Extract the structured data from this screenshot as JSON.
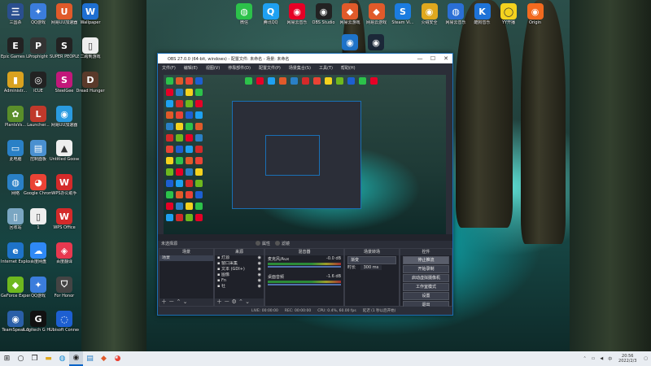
{
  "desktop": {
    "icons_left": [
      {
        "label": "三国杀",
        "color": "#2a4f8f",
        "glyph": "三"
      },
      {
        "label": "Epic Games Launcher",
        "color": "#222",
        "glyph": "E"
      },
      {
        "label": "Administr...",
        "color": "#d9a21f",
        "glyph": "▮"
      },
      {
        "label": "PlantsVs...",
        "color": "#5a8e2a",
        "glyph": "✿"
      },
      {
        "label": "此电脑",
        "color": "#2a80c6",
        "glyph": "▭"
      },
      {
        "label": "网络",
        "color": "#2a80c6",
        "glyph": "◍"
      },
      {
        "label": "回收站",
        "color": "#7aa6c2",
        "glyph": "▯"
      },
      {
        "label": "Internet Explorer",
        "color": "#1e73c9",
        "glyph": "e"
      },
      {
        "label": "GeForce Experience",
        "color": "#6eb81e",
        "glyph": "◆"
      },
      {
        "label": "TeamSpeak 3",
        "color": "#2a5fa8",
        "glyph": "◉"
      }
    ],
    "icons_col2": [
      {
        "label": "QQ游戏",
        "color": "#3b7ddc",
        "glyph": "✦"
      },
      {
        "label": "Prophight",
        "color": "#333",
        "glyph": "P"
      },
      {
        "label": "iCUE",
        "color": "#222",
        "glyph": "◎"
      },
      {
        "label": "Launcher...",
        "color": "#c0392b",
        "glyph": "L"
      },
      {
        "label": "控制面板",
        "color": "#4a90d0",
        "glyph": "▤"
      },
      {
        "label": "Google Chrome",
        "color": "#ea4335",
        "glyph": "◕"
      },
      {
        "label": "1",
        "color": "#eee",
        "glyph": "▯"
      },
      {
        "label": "百度网盘",
        "color": "#2f89f5",
        "glyph": "☁"
      },
      {
        "label": "QQ游戏",
        "color": "#3b7ddc",
        "glyph": "✦"
      },
      {
        "label": "Logitech G HUB",
        "color": "#111",
        "glyph": "G"
      }
    ],
    "icons_col3": [
      {
        "label": "网易UU加速器",
        "color": "#e05a2a",
        "glyph": "U"
      },
      {
        "label": "SUPER PEOPLE CBT",
        "color": "#222",
        "glyph": "S"
      },
      {
        "label": "SteelGee",
        "color": "#c2187a",
        "glyph": "S"
      },
      {
        "label": "网易UU加速器",
        "color": "#2a9be0",
        "glyph": "◉"
      },
      {
        "label": "Untitled Goose...",
        "color": "#eee",
        "glyph": "▲"
      },
      {
        "label": "WPS办公助手",
        "color": "#d42a2a",
        "glyph": "W"
      },
      {
        "label": "WPS Office",
        "color": "#d42a2a",
        "glyph": "W"
      },
      {
        "label": "百度翻译",
        "color": "#e8384f",
        "glyph": "◈"
      },
      {
        "label": "For Honor",
        "color": "#444",
        "glyph": "⛉"
      },
      {
        "label": "Ubisoft Connect",
        "color": "#1d5fd1",
        "glyph": "◌"
      }
    ],
    "icons_col4": [
      {
        "label": "Wallpaper",
        "color": "#1e6fd1",
        "glyph": "W"
      },
      {
        "label": "二跨到游戏",
        "color": "#eee",
        "glyph": "▯"
      },
      {
        "label": "Dread Hunger",
        "color": "#5a3a2a",
        "glyph": "D"
      }
    ],
    "icons_top": [
      {
        "label": "微信",
        "color": "#2cc24a",
        "glyph": "◍"
      },
      {
        "label": "腾讯QQ",
        "color": "#1ea1f2",
        "glyph": "Q"
      },
      {
        "label": "网易云音乐",
        "color": "#e60026",
        "glyph": "◉"
      },
      {
        "label": "OBS Studio",
        "color": "#222",
        "glyph": "◉"
      },
      {
        "label": "网易云游戏",
        "color": "#e05a2a",
        "glyph": "◆"
      },
      {
        "label": "网易云游戏",
        "color": "#e05a2a",
        "glyph": "◆"
      },
      {
        "label": "Steam Vi...",
        "color": "#1b7ce0",
        "glyph": "S"
      },
      {
        "label": "火绒安全",
        "color": "#e0a81e",
        "glyph": "◉"
      },
      {
        "label": "网易云音乐",
        "color": "#2a6fd6",
        "glyph": "◍"
      },
      {
        "label": "酷狗音乐",
        "color": "#1e73d8",
        "glyph": "K"
      },
      {
        "label": "YY开播",
        "color": "#f4d21e",
        "glyph": "◯"
      },
      {
        "label": "Origin",
        "color": "#f26a1f",
        "glyph": "◉"
      }
    ],
    "icons_top2": [
      {
        "label": "",
        "color": "#1e73c9",
        "glyph": "◉"
      },
      {
        "label": "",
        "color": "#1b2838",
        "glyph": "◉"
      }
    ]
  },
  "obs": {
    "title": "OBS 27.0.0 (64-bit, windows) - 配置文件: 未命名 - 场景: 未命名",
    "menu": [
      "文件(F)",
      "编辑(E)",
      "视图(V)",
      "停靠部件(D)",
      "配置文件(P)",
      "场景集合(S)",
      "工具(T)",
      "帮助(H)"
    ],
    "mode_label": "未选择源",
    "mode_props": "属性",
    "mode_filters": "滤镜",
    "docks": {
      "scenes": {
        "title": "场景",
        "items": [
          "场景"
        ]
      },
      "sources": {
        "title": "来源",
        "items": [
          "灯源",
          "窗口采集",
          "文本 (GDI+)",
          "图像",
          "Fn",
          "社"
        ]
      },
      "mixer": {
        "title": "混音器",
        "channels": [
          {
            "name": "麦克风/Aux",
            "db": "-0.0 dB"
          },
          {
            "name": "桌面音频",
            "db": "-1.6 dB"
          }
        ]
      },
      "transitions": {
        "title": "场景转场",
        "type": "渐变",
        "duration_label": "时长",
        "duration": "300 ms"
      },
      "controls": {
        "title": "控件",
        "buttons": [
          "停止推流",
          "开始录制",
          "启动虚拟摄像机",
          "工作室模式",
          "设置",
          "退出"
        ]
      }
    },
    "status": {
      "live": "LIVE: 00:00:00",
      "rec": "REC: 00:00:00",
      "cpu": "CPU: 0.4%, 60.00 fps",
      "extra": "延迟 (1 秒以后开始)"
    }
  },
  "taskbar": {
    "apps": [
      "start",
      "search",
      "task-view",
      "explorer",
      "edge",
      "obs",
      "file",
      "game",
      "chrome"
    ],
    "clock_time": "20:56",
    "clock_date": "2022/2/3"
  }
}
